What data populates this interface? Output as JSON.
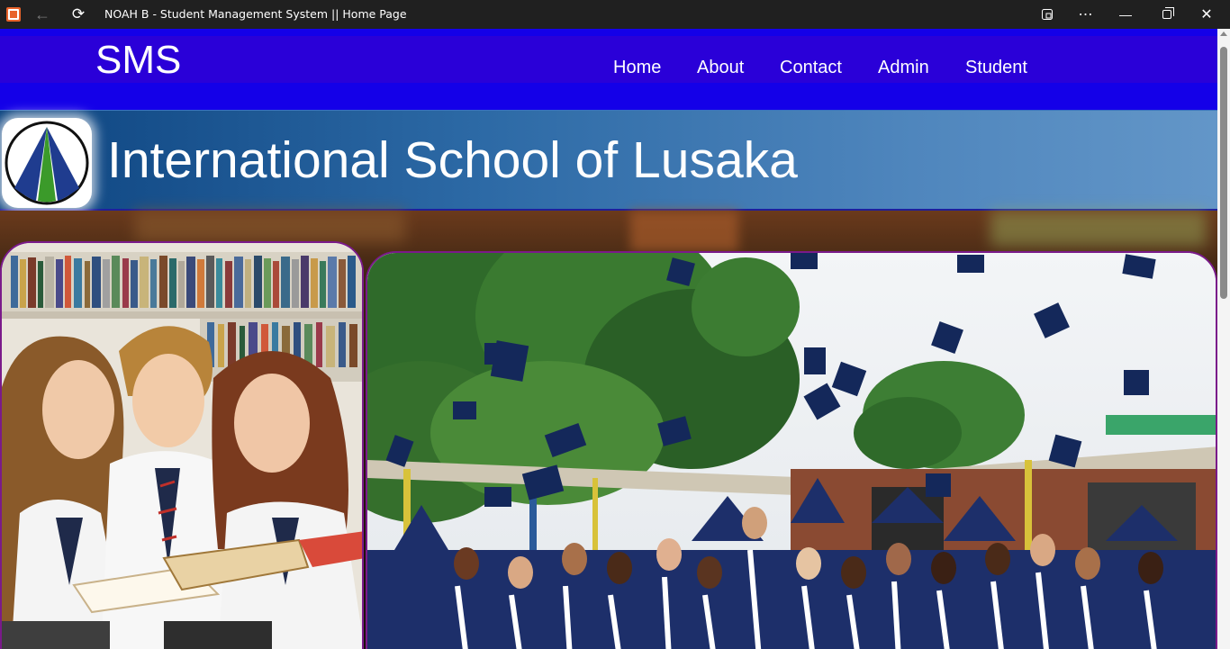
{
  "window": {
    "title": "NOAH B - Student Management System || Home Page",
    "icons": [
      "app-icon",
      "back-arrow-icon",
      "refresh-icon",
      "cast-icon",
      "more-icon",
      "minimize-icon",
      "maximize-icon",
      "close-icon"
    ]
  },
  "nav": {
    "brand": "SMS",
    "links": [
      {
        "label": "Home"
      },
      {
        "label": "About"
      },
      {
        "label": "Contact"
      },
      {
        "label": "Admin"
      },
      {
        "label": "Student"
      }
    ]
  },
  "banner": {
    "school_name": "International School of Lusaka"
  },
  "colors": {
    "nav_bg": "#1400e8",
    "nav_inner": "#2a00d8",
    "banner_start": "#0d4480",
    "banner_end": "#6396c8",
    "panel_border": "#7a1a8a",
    "titlebar": "#202020"
  }
}
